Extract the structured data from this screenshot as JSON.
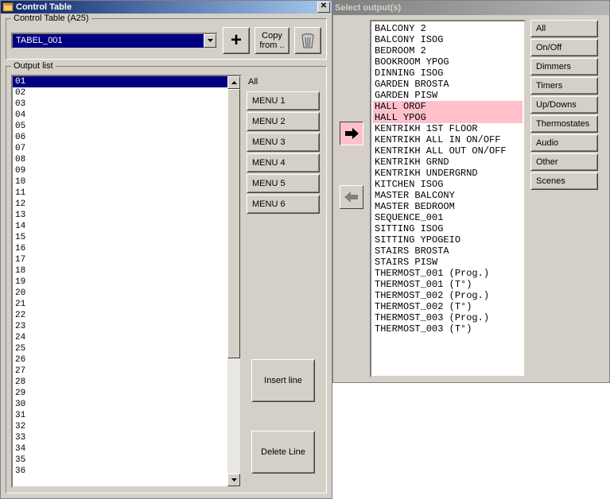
{
  "left": {
    "title": "Control Table",
    "group1": {
      "legend": "Control Table (A25)",
      "combo_value": "TABEL_001",
      "plus": "+",
      "copy_line1": "Copy",
      "copy_line2": "from .."
    },
    "output_legend": "Output list",
    "rows": [
      "01",
      "02",
      "03",
      "04",
      "05",
      "06",
      "07",
      "08",
      "09",
      "10",
      "11",
      "12",
      "13",
      "14",
      "15",
      "16",
      "17",
      "18",
      "19",
      "20",
      "21",
      "22",
      "23",
      "24",
      "25",
      "26",
      "27",
      "28",
      "29",
      "30",
      "31",
      "32",
      "33",
      "34",
      "35",
      "36"
    ],
    "selected_row": "01",
    "all_label": "All",
    "menu_buttons": [
      "MENU 1",
      "MENU 2",
      "MENU 3",
      "MENU 4",
      "MENU 5",
      "MENU 6"
    ],
    "insert_label": "Insert line",
    "delete_label": "Delete Line"
  },
  "right": {
    "title": "Select output(s)",
    "items": [
      "BALCONY 2",
      "BALCONY ISOG",
      "BEDROOM 2",
      "BOOKROOM YPOG",
      "DINNING ISOG",
      "GARDEN BROSTA",
      "GARDEN PISW",
      "HALL OROF",
      "HALL YPOG",
      "KENTRIKH 1ST FLOOR",
      "KENTRIKH ALL IN ON/OFF",
      "KENTRIKH ALL OUT ON/OFF",
      "KENTRIKH GRND",
      "KENTRIKH UNDERGRND",
      "KITCHEN ISOG",
      "MASTER BALCONY",
      "MASTER BEDROOM",
      "SEQUENCE_001",
      "SITTING ISOG",
      "SITTING YPOGEIO",
      "STAIRS BROSTA",
      "STAIRS PISW",
      "THERMOST_001 (Prog.)",
      "THERMOST_001 (T°)",
      "THERMOST_002 (Prog.)",
      "THERMOST_002 (T°)",
      "THERMOST_003 (Prog.)",
      "THERMOST_003 (T°)"
    ],
    "highlighted": [
      "HALL OROF",
      "HALL YPOG"
    ],
    "filters": [
      "All",
      "On/Off",
      "Dimmers",
      "Timers",
      "Up/Downs",
      "Thermostates",
      "Audio",
      "Other",
      "Scenes"
    ]
  }
}
